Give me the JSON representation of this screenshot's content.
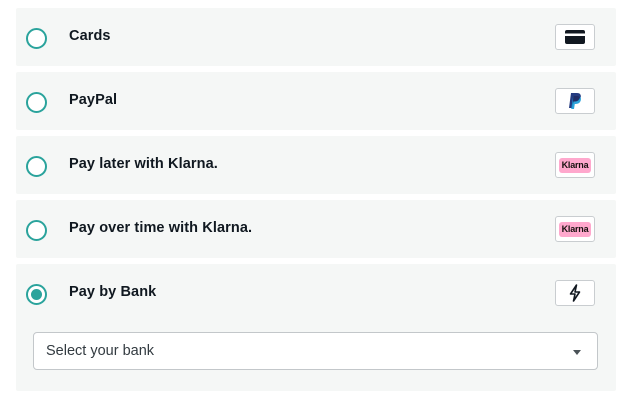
{
  "payment_methods": [
    {
      "label": "Cards",
      "icon": "credit-card-icon",
      "selected": false
    },
    {
      "label": "PayPal",
      "icon": "paypal-icon",
      "selected": false
    },
    {
      "label": "Pay later with Klarna.",
      "icon": "klarna-logo-icon",
      "logo_text": "Klarna",
      "selected": false
    },
    {
      "label": "Pay over time with Klarna.",
      "icon": "klarna-logo-icon",
      "logo_text": "Klarna",
      "selected": false
    },
    {
      "label": "Pay by Bank",
      "icon": "lightning-bolt-icon",
      "selected": true
    }
  ],
  "bank_select": {
    "placeholder": "Select your bank"
  },
  "colors": {
    "accent": "#2aa39c",
    "row_background": "#f5f7f6",
    "klarna_pink": "#ffa8cd",
    "text": "#101820"
  }
}
